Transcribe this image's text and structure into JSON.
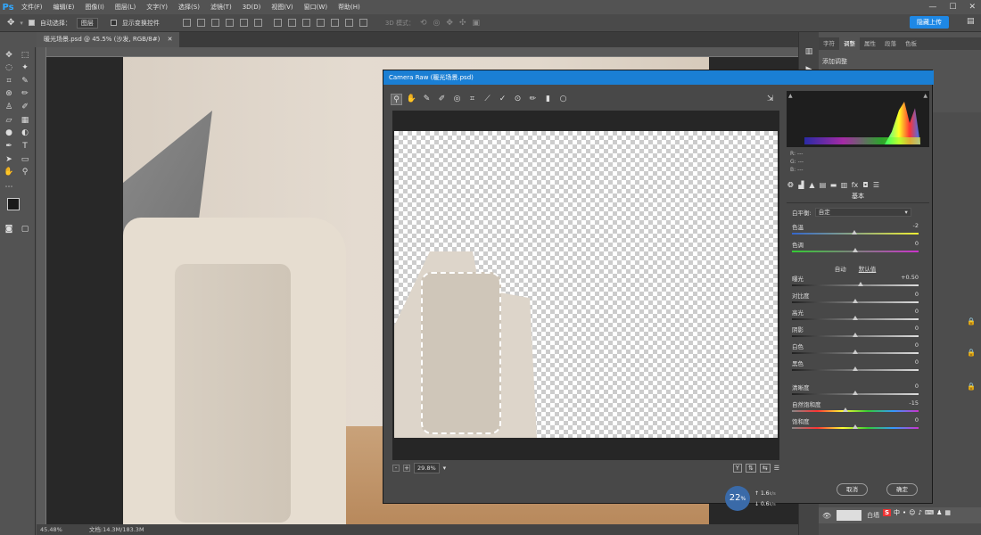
{
  "menubar": {
    "logo": "Ps",
    "items": [
      "文件(F)",
      "编辑(E)",
      "图像(I)",
      "图层(L)",
      "文字(Y)",
      "选择(S)",
      "滤镜(T)",
      "3D(D)",
      "视图(V)",
      "窗口(W)",
      "帮助(H)"
    ]
  },
  "optbar": {
    "auto_select_label": "自动选择：",
    "auto_select_value": "图层",
    "show_transform_label": "显示变换控件",
    "mode_3d_label": "3D 模式：",
    "share_label": "隐藏上传"
  },
  "document": {
    "tab_title": "暖光场景.psd @ 45.5% (沙发, RGB/8#)",
    "zoom_status": "45.48%",
    "doc_status": "文档:14.3M/183.3M"
  },
  "right_panel": {
    "tabs": [
      "字符",
      "调整",
      "属性",
      "段落",
      "色板"
    ],
    "active_tab": 1,
    "adjust_title": "添加调整",
    "layer_label": "白墙"
  },
  "dialog": {
    "title": "Camera Raw (暖光场景.psd)",
    "zoom_value": "29.8%",
    "rgb_readout": [
      "R: ---",
      "G: ---",
      "B: ---"
    ],
    "panel_title": "基本",
    "wb_label": "白平衡:",
    "wb_value": "自定",
    "auto_label": "自动",
    "default_label": "默认值",
    "cancel_label": "取消",
    "ok_label": "确定",
    "sliders": [
      {
        "label": "色温",
        "value": "-2",
        "pos": 0.49
      },
      {
        "label": "色调",
        "value": "0",
        "pos": 0.5
      },
      {
        "label": "曝光",
        "value": "+0.50",
        "pos": 0.54
      },
      {
        "label": "对比度",
        "value": "0",
        "pos": 0.5
      },
      {
        "label": "高光",
        "value": "0",
        "pos": 0.5
      },
      {
        "label": "阴影",
        "value": "0",
        "pos": 0.5
      },
      {
        "label": "白色",
        "value": "0",
        "pos": 0.5
      },
      {
        "label": "黑色",
        "value": "0",
        "pos": 0.5
      },
      {
        "label": "清晰度",
        "value": "0",
        "pos": 0.5
      },
      {
        "label": "自然饱和度",
        "value": "-15",
        "pos": 0.42
      },
      {
        "label": "饱和度",
        "value": "0",
        "pos": 0.5
      }
    ]
  },
  "overlay": {
    "speed_value": "22",
    "speed_unit": "%",
    "net_up": "1.6",
    "net_down": "0.6",
    "net_unit": "k/s"
  },
  "ime": {
    "label": "中"
  }
}
